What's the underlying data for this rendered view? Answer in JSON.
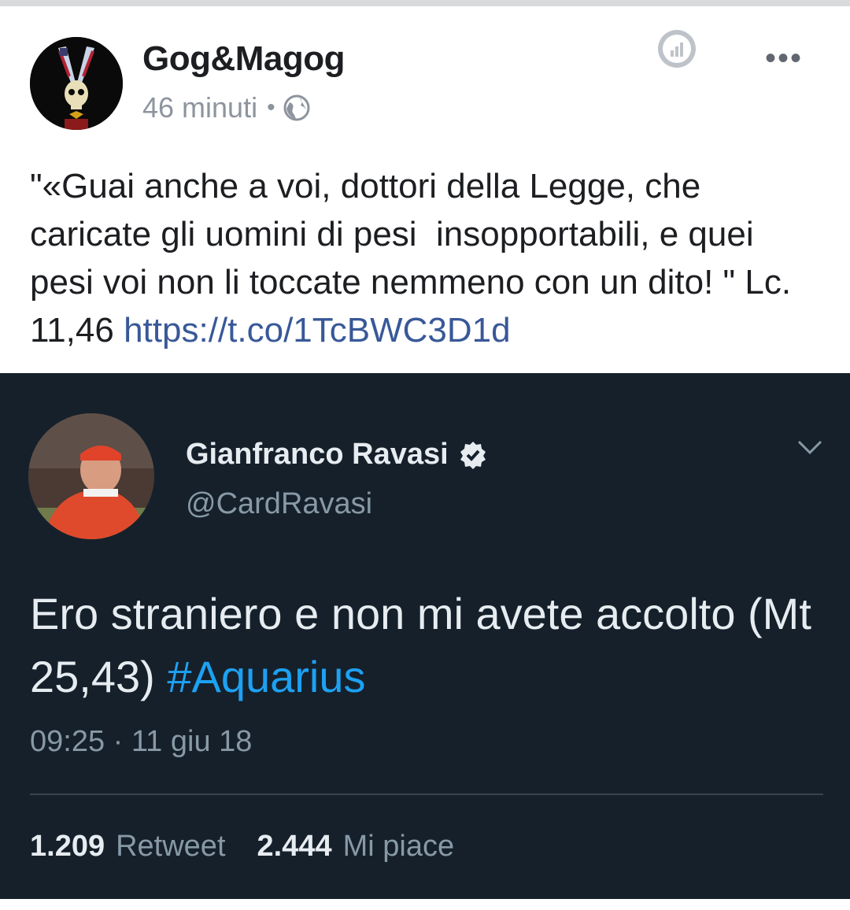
{
  "post": {
    "author": "Gog&Magog",
    "time": "46 minuti",
    "separator": "•",
    "privacy_icon": "globe-icon",
    "insights_icon": "bar-chart-icon",
    "more_icon": "ellipsis-icon",
    "more_label": "•••",
    "text": "\"«Guai anche a voi, dottori della Legge, che caricate gli uomini di pesi  insopportabili, e quei pesi voi non li toccate nemmeno con un dito! \" Lc. 11,46 ",
    "link": "https://t.co/1TcBWC3D1d"
  },
  "tweet": {
    "name": "Gianfranco Ravasi",
    "handle": "@CardRavasi",
    "verified_icon": "verified-badge-icon",
    "menu_icon": "chevron-down-icon",
    "text": "Ero straniero e non mi avete accolto (Mt 25,43) ",
    "hashtag": "#Aquarius",
    "timestamp": "09:25 · 11 giu 18",
    "retweet_count": "1.209",
    "retweet_label": "Retweet",
    "like_count": "2.444",
    "like_label": "Mi piace"
  },
  "colors": {
    "fb_link": "#385898",
    "tweet_bg": "#15202b",
    "tweet_hashtag": "#1da1f2"
  }
}
